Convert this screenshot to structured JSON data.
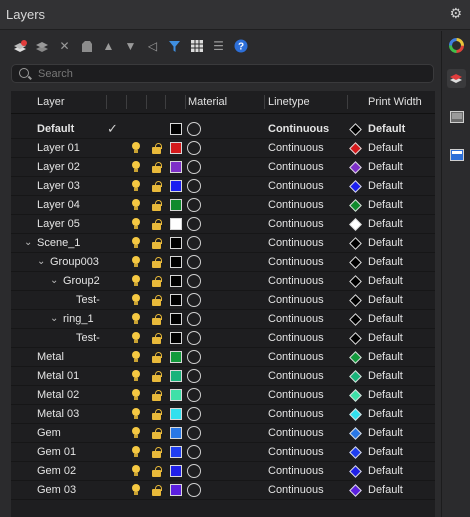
{
  "window": {
    "title": "Layers"
  },
  "toolbar": {
    "icons": [
      "new-layer-icon",
      "new-sublayer-icon",
      "delete-icon",
      "purge-icon",
      "move-up-icon",
      "move-down-icon",
      "collapse-icon",
      "filter-icon",
      "grid-icon",
      "list-icon",
      "help-icon"
    ]
  },
  "search": {
    "placeholder": "Search",
    "value": ""
  },
  "columns": {
    "layer": "Layer",
    "material": "Material",
    "linetype": "Linetype",
    "print_width": "Print Width"
  },
  "rows": [
    {
      "name": "Default",
      "color": "#000000",
      "linetype": "Continuous",
      "print_width": "Default",
      "diamond": "#000000",
      "bold": true,
      "current": true
    },
    {
      "name": "Layer 01",
      "color": "#d4191b",
      "linetype": "Continuous",
      "print_width": "Default",
      "diamond": "#d4191b"
    },
    {
      "name": "Layer 02",
      "color": "#7d2fc7",
      "linetype": "Continuous",
      "print_width": "Default",
      "diamond": "#7d2fc7"
    },
    {
      "name": "Layer 03",
      "color": "#1b1ff0",
      "linetype": "Continuous",
      "print_width": "Default",
      "diamond": "#1b1ff0"
    },
    {
      "name": "Layer 04",
      "color": "#0f8a2c",
      "linetype": "Continuous",
      "print_width": "Default",
      "diamond": "#0f8a2c"
    },
    {
      "name": "Layer 05",
      "color": "#ffffff",
      "linetype": "Continuous",
      "print_width": "Default",
      "diamond": "#ffffff"
    },
    {
      "name": "Scene_1",
      "color": "#000000",
      "linetype": "Continuous",
      "print_width": "Default",
      "diamond": "#000000",
      "indent": 0,
      "expanded": true
    },
    {
      "name": "Group003",
      "color": "#000000",
      "linetype": "Continuous",
      "print_width": "Default",
      "diamond": "#000000",
      "indent": 1,
      "expanded": true
    },
    {
      "name": "Group2",
      "color": "#000000",
      "linetype": "Continuous",
      "print_width": "Default",
      "diamond": "#000000",
      "indent": 2,
      "expanded": true
    },
    {
      "name": "Test-",
      "color": "#000000",
      "linetype": "Continuous",
      "print_width": "Default",
      "diamond": "#000000",
      "indent": 3
    },
    {
      "name": "ring_1",
      "color": "#000000",
      "linetype": "Continuous",
      "print_width": "Default",
      "diamond": "#000000",
      "indent": 2,
      "expanded": true
    },
    {
      "name": "Test-",
      "color": "#000000",
      "linetype": "Continuous",
      "print_width": "Default",
      "diamond": "#000000",
      "indent": 3
    },
    {
      "name": "Metal",
      "color": "#129a3c",
      "linetype": "Continuous",
      "print_width": "Default",
      "diamond": "#129a3c"
    },
    {
      "name": "Metal 01",
      "color": "#19b37a",
      "linetype": "Continuous",
      "print_width": "Default",
      "diamond": "#19b37a"
    },
    {
      "name": "Metal 02",
      "color": "#3fe0a8",
      "linetype": "Continuous",
      "print_width": "Default",
      "diamond": "#3fe0a8"
    },
    {
      "name": "Metal 03",
      "color": "#32e0ee",
      "linetype": "Continuous",
      "print_width": "Default",
      "diamond": "#32e0ee"
    },
    {
      "name": "Gem",
      "color": "#2a78e6",
      "linetype": "Continuous",
      "print_width": "Default",
      "diamond": "#2a78e6"
    },
    {
      "name": "Gem 01",
      "color": "#1f3ef0",
      "linetype": "Continuous",
      "print_width": "Default",
      "diamond": "#1f3ef0"
    },
    {
      "name": "Gem 02",
      "color": "#2020e8",
      "linetype": "Continuous",
      "print_width": "Default",
      "diamond": "#2020e8"
    },
    {
      "name": "Gem 03",
      "color": "#5b1fe0",
      "linetype": "Continuous",
      "print_width": "Default",
      "diamond": "#5b1fe0"
    }
  ],
  "right_panel": {
    "icons": [
      "color-wheel-icon",
      "layers-icon",
      "display-icon",
      "monitor-icon"
    ]
  }
}
